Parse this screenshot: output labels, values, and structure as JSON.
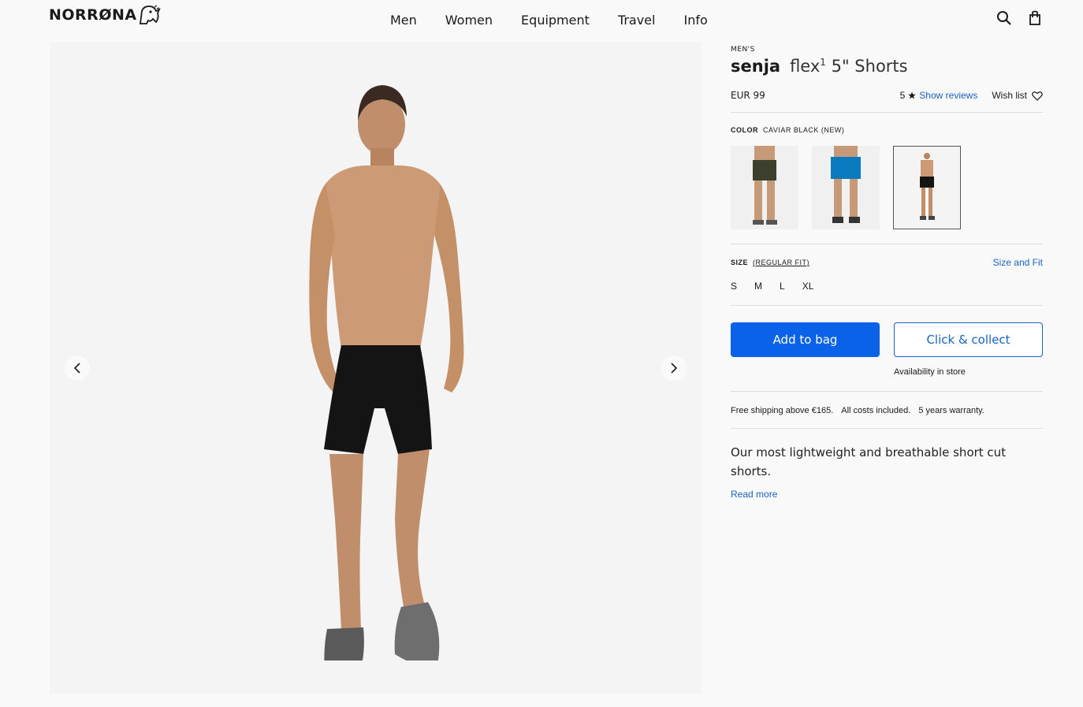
{
  "header": {
    "logo": "NORRØNA",
    "nav": [
      "Men",
      "Women",
      "Equipment",
      "Travel",
      "Info"
    ],
    "icons": [
      "search-icon",
      "bag-icon"
    ]
  },
  "gallery": {
    "prev_icon": "chevron-left-icon",
    "next_icon": "chevron-right-icon"
  },
  "product": {
    "gender": "MEN'S",
    "brand": "senja",
    "model": "flex",
    "model_sup": "1",
    "name_rest": "5\" Shorts",
    "price": "EUR 99",
    "rating": "5",
    "show_reviews": "Show reviews",
    "wish_list": "Wish list",
    "color_label": "COLOR",
    "color_value": "CAVIAR BLACK (NEW)",
    "swatches": [
      {
        "color": "#3b3f2c",
        "name": "olive"
      },
      {
        "color": "#0b7bc0",
        "name": "blue"
      },
      {
        "color": "#141414",
        "name": "caviar-black"
      }
    ],
    "size_label": "SIZE",
    "fit": "(REGULAR FIT)",
    "size_and_fit": "Size and Fit",
    "sizes": [
      "S",
      "M",
      "L",
      "XL"
    ],
    "add_to_bag": "Add to bag",
    "click_collect": "Click & collect",
    "availability": "Availability in store",
    "shipping": [
      "Free shipping above €165.",
      "All costs included.",
      "5 years warranty."
    ],
    "description": "Our most lightweight and breathable short cut shorts.",
    "read_more": "Read more"
  },
  "colors": {
    "accent": "#0a62e8",
    "link": "#1a62c4",
    "background": "#f9f9f9",
    "image_bg": "#f4f4f4"
  }
}
